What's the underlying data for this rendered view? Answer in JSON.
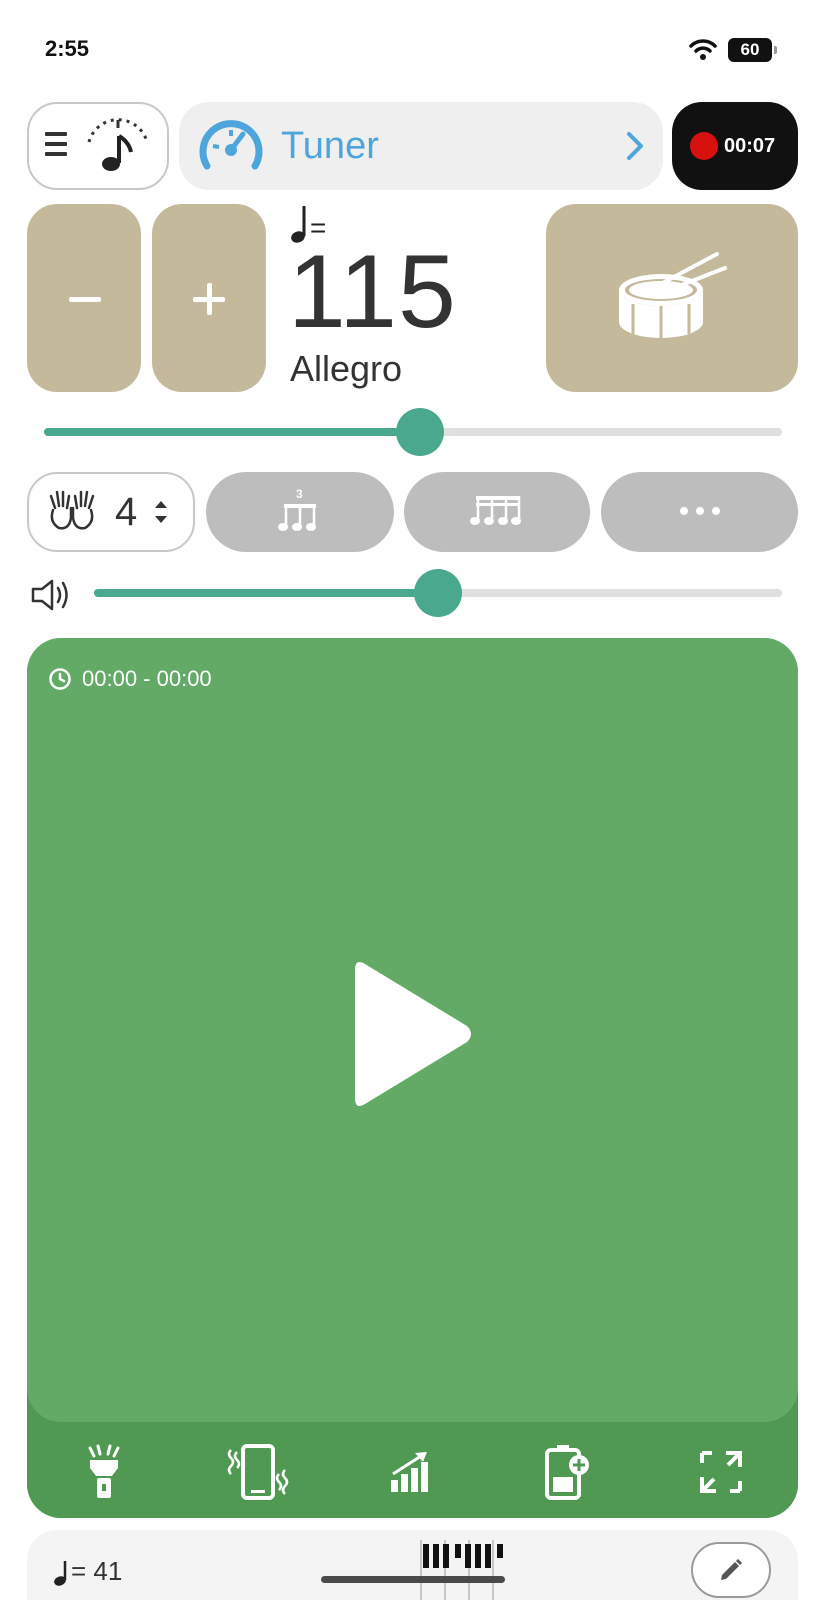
{
  "status_bar": {
    "time": "2:55",
    "battery": "60"
  },
  "header": {
    "menu_icon": "hamburger-menu-icon",
    "metronome_icon": "metronome-note-icon",
    "tuner_label": "Tuner",
    "record_time": "00:07"
  },
  "tempo": {
    "note_equals": "=",
    "bpm": "115",
    "name": "Allegro",
    "slider_fraction": 0.51
  },
  "controls": {
    "beats_per_measure": "4",
    "volume_fraction": 0.5
  },
  "play_panel": {
    "timer": "00:00 - 00:00",
    "toolbar": [
      "flashlight-icon",
      "vibrate-icon",
      "accelerate-icon",
      "battery-saver-icon",
      "fullscreen-icon"
    ]
  },
  "bottom_bar": {
    "note_equals": "= 41"
  },
  "colors": {
    "accent_teal": "#4aa88e",
    "tempo_buttons": "#c4b99b",
    "play_panel": "#63aa67",
    "tuner_blue": "#4ea5dc",
    "record_red": "#d81010"
  }
}
